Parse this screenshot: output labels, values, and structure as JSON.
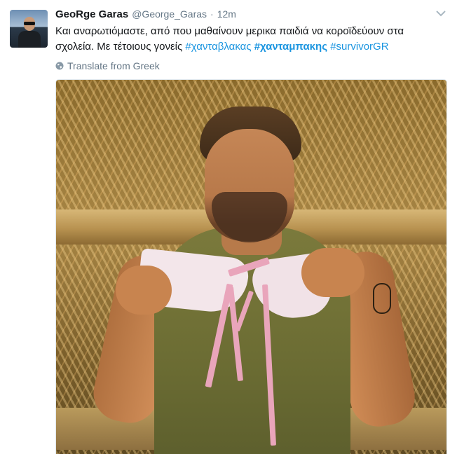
{
  "tweet": {
    "author_name": "GeoRge Garas",
    "handle": "@George_Garas",
    "separator": "·",
    "time": "12m",
    "text_line1": "Και αναρωτιόμαστε, από που μαθαίνουν μερικα παιδιά να κοροϊδεύουν στα",
    "text_line2_plain": "σχολεία. Με τέτοιους γονείς ",
    "hashtags": [
      "#χανταβλακας",
      "#χανταμπακης",
      "#survivorGR"
    ],
    "translate_label": "Translate from Greek"
  },
  "icons": {
    "avatar": "avatar-photo",
    "more": "chevron-down-icon",
    "translate": "globe-icon"
  },
  "colors": {
    "text": "#14171a",
    "secondary": "#657786",
    "hashtag": "#1b95e0"
  }
}
